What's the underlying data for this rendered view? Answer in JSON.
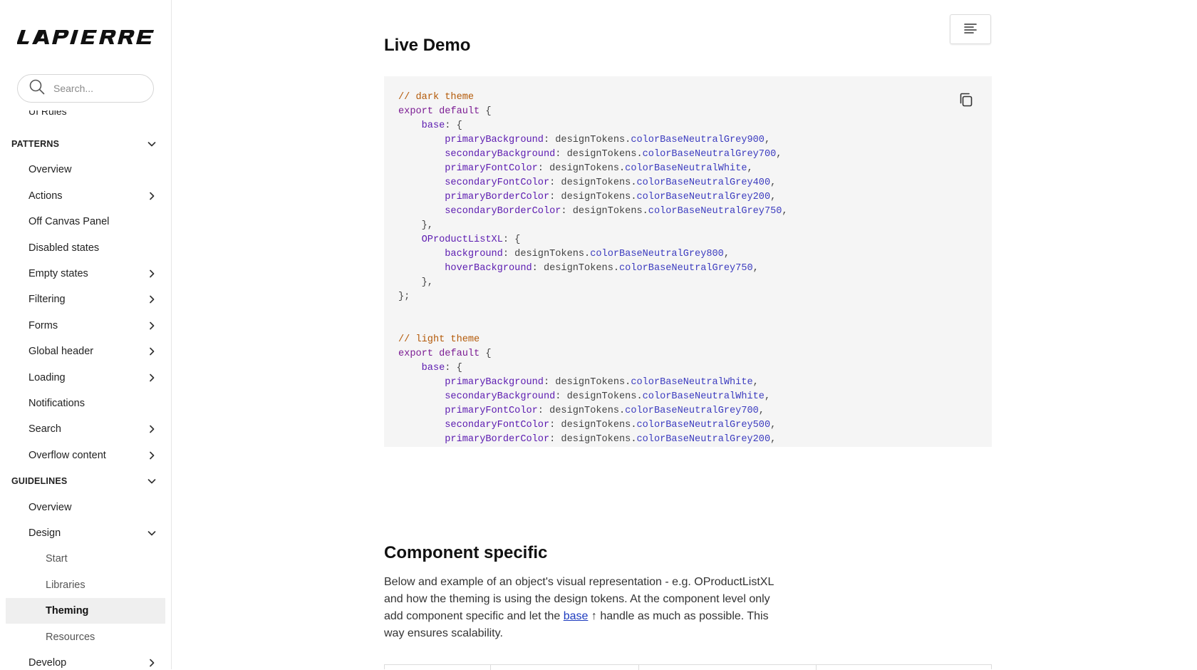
{
  "brand": {
    "logo_text": "LAPIERRE"
  },
  "search": {
    "placeholder": "Search..."
  },
  "sidebar": {
    "cut_item": "UI Rules",
    "items": [
      {
        "label": "PATTERNS",
        "type": "section",
        "chevron": "down"
      },
      {
        "label": "Overview",
        "type": "l1",
        "chevron": ""
      },
      {
        "label": "Actions",
        "type": "l1",
        "chevron": "right"
      },
      {
        "label": "Off Canvas Panel",
        "type": "l1",
        "chevron": ""
      },
      {
        "label": "Disabled states",
        "type": "l1",
        "chevron": ""
      },
      {
        "label": "Empty states",
        "type": "l1",
        "chevron": "right"
      },
      {
        "label": "Filtering",
        "type": "l1",
        "chevron": "right"
      },
      {
        "label": "Forms",
        "type": "l1",
        "chevron": "right"
      },
      {
        "label": "Global header",
        "type": "l1",
        "chevron": "right"
      },
      {
        "label": "Loading",
        "type": "l1",
        "chevron": "right"
      },
      {
        "label": "Notifications",
        "type": "l1",
        "chevron": ""
      },
      {
        "label": "Search",
        "type": "l1",
        "chevron": "right"
      },
      {
        "label": "Overflow content",
        "type": "l1",
        "chevron": "right"
      },
      {
        "label": "GUIDELINES",
        "type": "section",
        "chevron": "down"
      },
      {
        "label": "Overview",
        "type": "l1",
        "chevron": ""
      },
      {
        "label": "Design",
        "type": "l1",
        "chevron": "down"
      },
      {
        "label": "Start",
        "type": "l2",
        "chevron": ""
      },
      {
        "label": "Libraries",
        "type": "l2",
        "chevron": ""
      },
      {
        "label": "Theming",
        "type": "l2",
        "chevron": "",
        "active": true
      },
      {
        "label": "Resources",
        "type": "l2",
        "chevron": ""
      },
      {
        "label": "Develop",
        "type": "l1",
        "chevron": "right"
      }
    ]
  },
  "main": {
    "live_demo_title": "Live Demo",
    "component_specific_title": "Component specific",
    "paragraph_before_link": "Below and example of an object's visual representation - e.g. OProductListXL and how the theming is using the design tokens. At the component level only add component specific and let the ",
    "link_text": "base",
    "link_arrow": "↑",
    "paragraph_after_link": " handle as much as possible. This way ensures scalability.",
    "code_lines": [
      [
        [
          "// dark theme",
          "com"
        ]
      ],
      [
        [
          "export default",
          "kw"
        ],
        [
          " {",
          "pl"
        ]
      ],
      [
        [
          "    ",
          "pl"
        ],
        [
          "base",
          "key"
        ],
        [
          ": {",
          "pl"
        ]
      ],
      [
        [
          "        ",
          "pl"
        ],
        [
          "primaryBackground",
          "key"
        ],
        [
          ": designTokens.",
          "pl"
        ],
        [
          "colorBaseNeutralGrey900",
          "prop"
        ],
        [
          ",",
          "pl"
        ]
      ],
      [
        [
          "        ",
          "pl"
        ],
        [
          "secondaryBackground",
          "key"
        ],
        [
          ": designTokens.",
          "pl"
        ],
        [
          "colorBaseNeutralGrey700",
          "prop"
        ],
        [
          ",",
          "pl"
        ]
      ],
      [
        [
          "        ",
          "pl"
        ],
        [
          "primaryFontColor",
          "key"
        ],
        [
          ": designTokens.",
          "pl"
        ],
        [
          "colorBaseNeutralWhite",
          "prop"
        ],
        [
          ",",
          "pl"
        ]
      ],
      [
        [
          "        ",
          "pl"
        ],
        [
          "secondaryFontColor",
          "key"
        ],
        [
          ": designTokens.",
          "pl"
        ],
        [
          "colorBaseNeutralGrey400",
          "prop"
        ],
        [
          ",",
          "pl"
        ]
      ],
      [
        [
          "        ",
          "pl"
        ],
        [
          "primaryBorderColor",
          "key"
        ],
        [
          ": designTokens.",
          "pl"
        ],
        [
          "colorBaseNeutralGrey200",
          "prop"
        ],
        [
          ",",
          "pl"
        ]
      ],
      [
        [
          "        ",
          "pl"
        ],
        [
          "secondaryBorderColor",
          "key"
        ],
        [
          ": designTokens.",
          "pl"
        ],
        [
          "colorBaseNeutralGrey750",
          "prop"
        ],
        [
          ",",
          "pl"
        ]
      ],
      [
        [
          "    },",
          "pl"
        ]
      ],
      [
        [
          "    ",
          "pl"
        ],
        [
          "OProductListXL",
          "key"
        ],
        [
          ": {",
          "pl"
        ]
      ],
      [
        [
          "        ",
          "pl"
        ],
        [
          "background",
          "key"
        ],
        [
          ": designTokens.",
          "pl"
        ],
        [
          "colorBaseNeutralGrey800",
          "prop"
        ],
        [
          ",",
          "pl"
        ]
      ],
      [
        [
          "        ",
          "pl"
        ],
        [
          "hoverBackground",
          "key"
        ],
        [
          ": designTokens.",
          "pl"
        ],
        [
          "colorBaseNeutralGrey750",
          "prop"
        ],
        [
          ",",
          "pl"
        ]
      ],
      [
        [
          "    },",
          "pl"
        ]
      ],
      [
        [
          "};",
          "pl"
        ]
      ],
      [
        [
          "",
          "pl"
        ]
      ],
      [
        [
          "",
          "pl"
        ]
      ],
      [
        [
          "// light theme",
          "com"
        ]
      ],
      [
        [
          "export default",
          "kw"
        ],
        [
          " {",
          "pl"
        ]
      ],
      [
        [
          "    ",
          "pl"
        ],
        [
          "base",
          "key"
        ],
        [
          ": {",
          "pl"
        ]
      ],
      [
        [
          "        ",
          "pl"
        ],
        [
          "primaryBackground",
          "key"
        ],
        [
          ": designTokens.",
          "pl"
        ],
        [
          "colorBaseNeutralWhite",
          "prop"
        ],
        [
          ",",
          "pl"
        ]
      ],
      [
        [
          "        ",
          "pl"
        ],
        [
          "secondaryBackground",
          "key"
        ],
        [
          ": designTokens.",
          "pl"
        ],
        [
          "colorBaseNeutralWhite",
          "prop"
        ],
        [
          ",",
          "pl"
        ]
      ],
      [
        [
          "        ",
          "pl"
        ],
        [
          "primaryFontColor",
          "key"
        ],
        [
          ": designTokens.",
          "pl"
        ],
        [
          "colorBaseNeutralGrey700",
          "prop"
        ],
        [
          ",",
          "pl"
        ]
      ],
      [
        [
          "        ",
          "pl"
        ],
        [
          "secondaryFontColor",
          "key"
        ],
        [
          ": designTokens.",
          "pl"
        ],
        [
          "colorBaseNeutralGrey500",
          "prop"
        ],
        [
          ",",
          "pl"
        ]
      ],
      [
        [
          "        ",
          "pl"
        ],
        [
          "primaryBorderColor",
          "key"
        ],
        [
          ": designTokens.",
          "pl"
        ],
        [
          "colorBaseNeutralGrey200",
          "prop"
        ],
        [
          ",",
          "pl"
        ]
      ]
    ]
  },
  "icons": {
    "search": "search-icon",
    "toc": "table-of-contents-icon",
    "copy": "copy-icon",
    "chevron_right": "chevron-right-icon",
    "chevron_down": "chevron-down-icon"
  },
  "colors": {
    "code_background": "#f5f5f5",
    "active_nav_background": "#efefef",
    "link": "#1d3bbf",
    "comment": "#b45a09",
    "keyword": "#7b1c93",
    "key": "#5b1ab0",
    "property": "#3c3cbf"
  }
}
